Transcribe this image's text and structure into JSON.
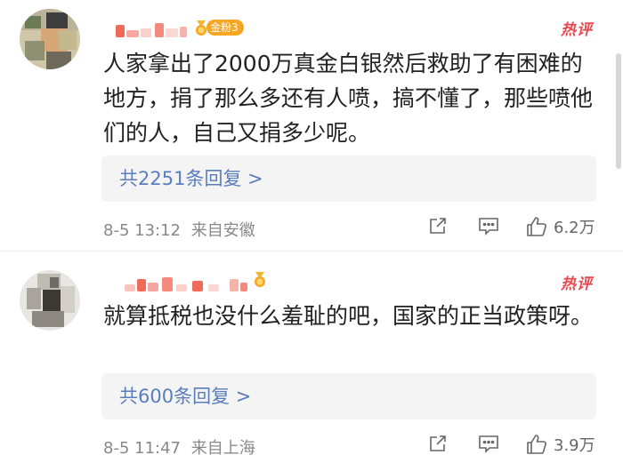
{
  "comments": [
    {
      "badge": "金粉3",
      "hot_label": "热评",
      "text": "人家拿出了2000万真金白银然后救助了有困难的地方，捐了那么多还有人喷，搞不懂了，那些喷他们的人，自己又捐多少呢。",
      "replies": "共2251条回复 >",
      "datetime": "8-5 13:12",
      "location": "来自安徽",
      "likes": "6.2万"
    },
    {
      "badge": "",
      "hot_label": "热评",
      "text": "就算抵税也没什么羞耻的吧，国家的正当政策呀。",
      "replies": "共600条回复 >",
      "datetime": "8-5 11:47",
      "location": "来自上海",
      "likes": "3.9万"
    }
  ],
  "colors": {
    "hot": "#e8484f",
    "reply_link": "#5a7dbe",
    "badge": "#f5a623"
  },
  "icons": [
    "share-icon",
    "comment-icon",
    "like-icon",
    "medal-icon"
  ]
}
